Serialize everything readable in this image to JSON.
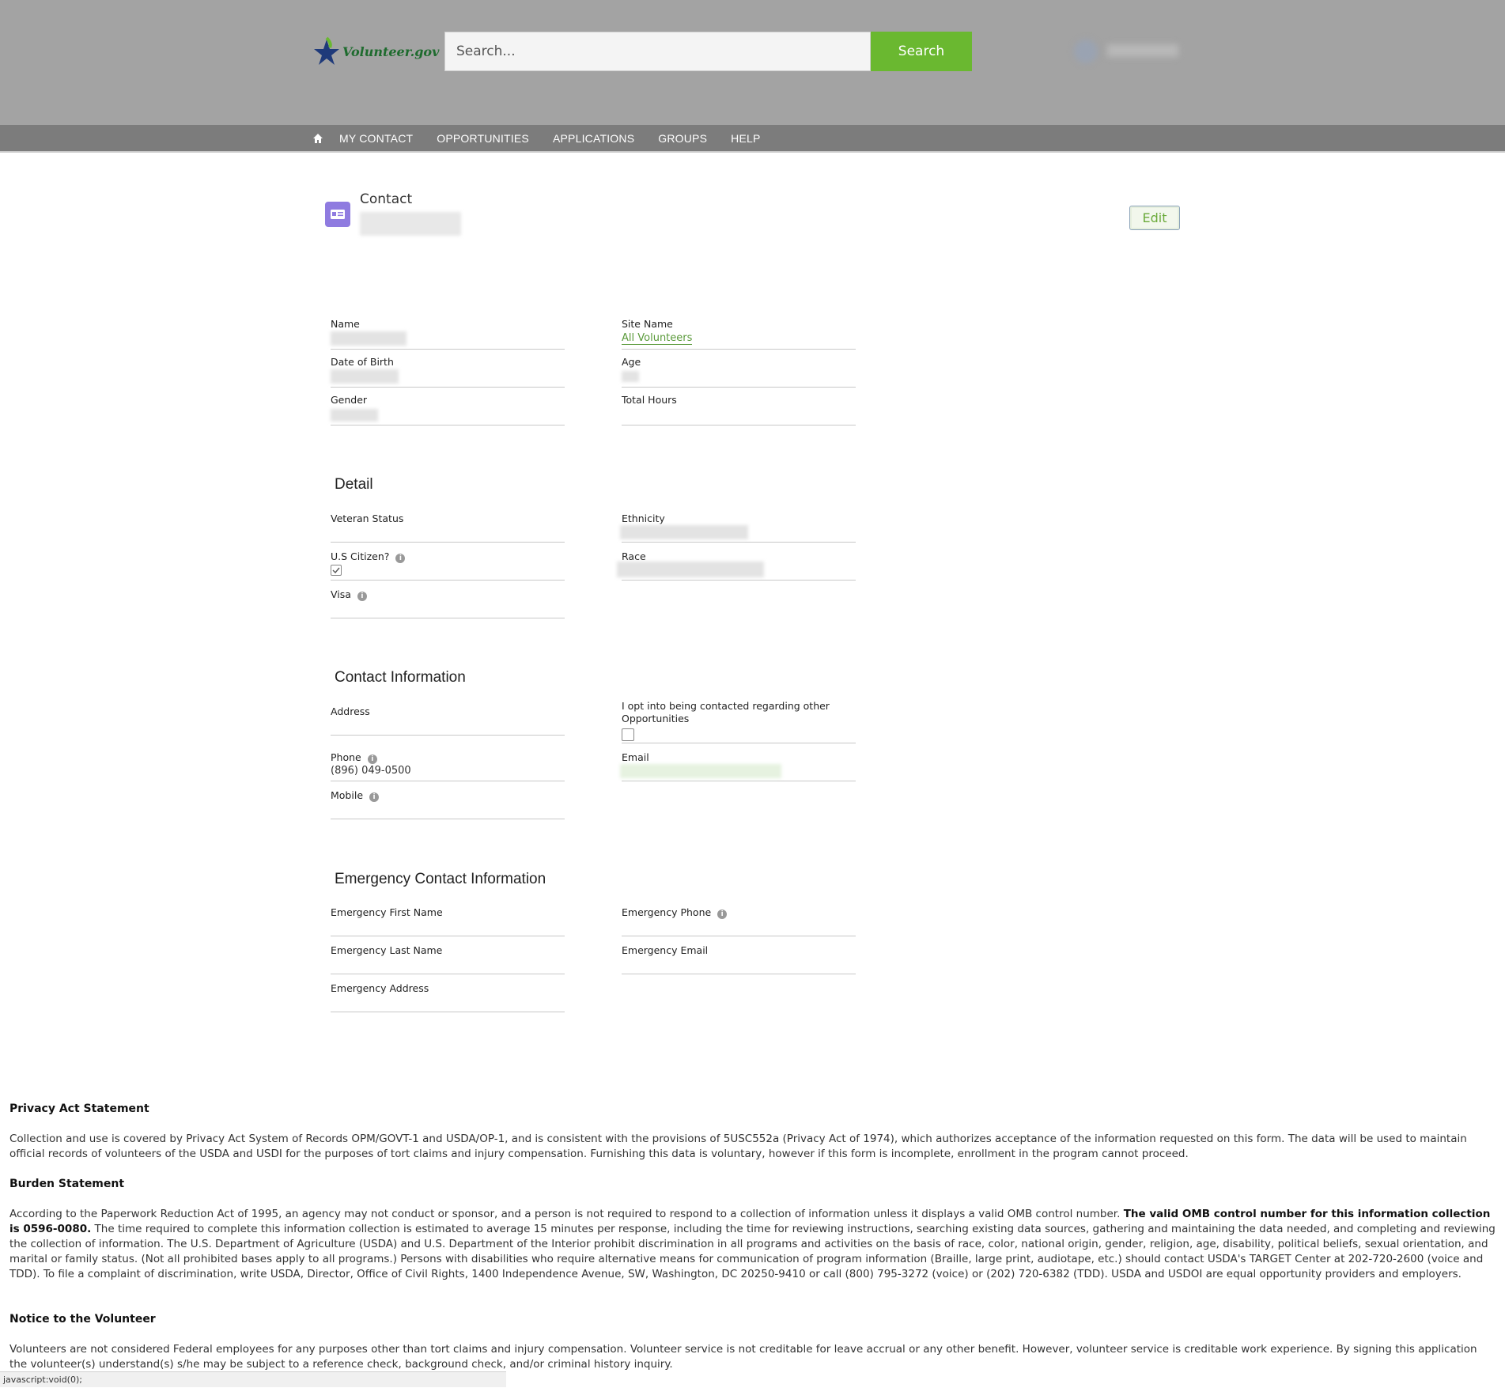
{
  "header": {
    "logo_text": "Volunteer.gov",
    "search_placeholder": "Search...",
    "search_button": "Search"
  },
  "nav": {
    "items": [
      "MY CONTACT",
      "OPPORTUNITIES",
      "APPLICATIONS",
      "GROUPS",
      "HELP"
    ]
  },
  "contact": {
    "title": "Contact",
    "edit_button": "Edit"
  },
  "fields": {
    "name": "Name",
    "site_name": "Site Name",
    "site_name_value": "All Volunteers",
    "dob": "Date of Birth",
    "age": "Age",
    "gender": "Gender",
    "total_hours": "Total Hours"
  },
  "detail": {
    "title": "Detail",
    "veteran_status": "Veteran Status",
    "ethnicity": "Ethnicity",
    "us_citizen": "U.S Citizen?",
    "us_citizen_checked": true,
    "race": "Race",
    "visa": "Visa"
  },
  "contact_info": {
    "title": "Contact Information",
    "address": "Address",
    "opt_in": "I opt into being contacted regarding other Opportunities",
    "phone": "Phone",
    "phone_value": "(896) 049-0500",
    "email": "Email",
    "mobile": "Mobile"
  },
  "emergency": {
    "title": "Emergency Contact Information",
    "first_name": "Emergency First Name",
    "phone": "Emergency Phone",
    "last_name": "Emergency Last Name",
    "email": "Emergency Email",
    "address": "Emergency Address"
  },
  "footer": {
    "privacy_title": "Privacy Act Statement",
    "privacy_text": "Collection and use is covered by Privacy Act System of Records OPM/GOVT-1 and USDA/OP-1, and is consistent with the provisions of 5USC552a (Privacy Act of 1974), which authorizes acceptance of the information requested on this form. The data will be used to maintain official records of volunteers of the USDA and USDI for the purposes of tort claims and injury compensation. Furnishing this data is voluntary, however if this form is incomplete, enrollment in the program cannot proceed.",
    "burden_title": "Burden Statement",
    "burden_text_1": "According to the Paperwork Reduction Act of 1995, an agency may not conduct or sponsor, and a person is not required to respond to a collection of information unless it displays a valid OMB control number.",
    "burden_bold": "The valid OMB control number for this information collection is 0596-0080.",
    "burden_text_2": "The time required to complete this information collection is estimated to average 15 minutes per response, including the time for reviewing instructions, searching existing data sources, gathering and maintaining the data needed, and completing and reviewing the collection of information. The U.S. Department of Agriculture (USDA) and U.S. Department of the Interior prohibit discrimination in all programs and activities on the basis of race, color, national origin, gender, religion, age, disability, political beliefs, sexual orientation, and marital or family status. (Not all prohibited bases apply to all programs.) Persons with disabilities who require alternative means for communication of program information (Braille, large print, audiotape, etc.) should contact USDA's TARGET Center at 202-720-2600 (voice and TDD). To file a complaint of discrimination, write USDA, Director, Office of Civil Rights, 1400 Independence Avenue, SW, Washington, DC 20250-9410 or call (800) 795-3272 (voice) or (202) 720-6382 (TDD). USDA and USDOI are equal opportunity providers and employers.",
    "notice_title": "Notice to the Volunteer",
    "notice_text": "Volunteers are not considered Federal employees for any purposes other than tort claims and injury compensation. Volunteer service is not creditable for leave accrual or any other benefit. However, volunteer service is creditable work experience. By signing this application the volunteer(s) understand(s) s/he may be subject to a reference check, background check, and/or criminal history inquiry."
  },
  "status_bar": "javascript:void(0);",
  "colors": {
    "header_bg": "#a3a3a3",
    "nav_bg": "#7c7c7c",
    "accent_green": "#6ab830",
    "link_green": "#5a9a3a",
    "contact_icon": "#8f7be0"
  }
}
